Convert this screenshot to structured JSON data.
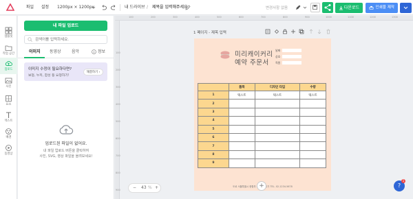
{
  "topbar": {
    "file": "파일",
    "settings": "설정",
    "size": "1200px × 1200px",
    "drive": "내 드라이브",
    "slash": "/",
    "doc_title": "제목을 입력해주세요.",
    "save_status": "변경사항 없음",
    "download": "다운로드",
    "order": "인쇄물 제작"
  },
  "rail": [
    {
      "label": "템플릿",
      "icon": "template-icon"
    },
    {
      "label": "작업 공간",
      "icon": "workspace-icon"
    },
    {
      "label": "업로드",
      "icon": "upload-cloud-icon"
    },
    {
      "label": "사진",
      "icon": "photo-icon"
    },
    {
      "label": "요소",
      "icon": "element-icon"
    },
    {
      "label": "텍스트",
      "icon": "text-icon"
    },
    {
      "label": "배경",
      "icon": "background-icon"
    },
    {
      "label": "동영상",
      "icon": "video-icon"
    }
  ],
  "panel": {
    "upload_button": "내 파일 업로드",
    "search_placeholder": "검색어를 입력하세요.",
    "tabs": [
      "이미지",
      "동영상",
      "음악",
      "정보"
    ],
    "banner_title": "이미지 수정이 필요하다면?",
    "banner_sub": "보정, 누끼, 합성 등 요청하기!",
    "banner_button": "해결하기",
    "empty_title": "업로드된 파일이 없어요.",
    "empty_desc1": "내 파일 업로드 버튼을 클릭하여",
    "empty_desc2": "사진, SVG, 영상 파일을 올려보세요!"
  },
  "canvas": {
    "page_label": "1 페이지 - 제목 입력",
    "zoom_value": "43",
    "zoom_unit": "%",
    "ruler_top": [
      "100",
      "200",
      "300",
      "400",
      "500",
      "600",
      "700",
      "800",
      "900",
      "1000",
      "1100",
      "1200",
      "1300"
    ],
    "ruler_left": [
      "100",
      "200",
      "300",
      "400",
      "500",
      "600",
      "700",
      "800",
      "900"
    ]
  },
  "document": {
    "title_line1": "미리캐이커리",
    "title_line2": "예약 주문서",
    "fields": [
      "날짜",
      "상호",
      "직원"
    ],
    "headers": [
      "품목",
      "디자인 타입",
      "수량"
    ],
    "rows": [
      {
        "num": "1",
        "c1": "텍스트",
        "c2": "텍스트",
        "c3": "텍스트"
      },
      {
        "num": "2",
        "c1": "",
        "c2": "",
        "c3": ""
      },
      {
        "num": "3",
        "c1": "",
        "c2": "",
        "c3": ""
      },
      {
        "num": "4",
        "c1": "",
        "c2": "",
        "c3": ""
      },
      {
        "num": "5",
        "c1": "",
        "c2": "",
        "c3": ""
      },
      {
        "num": "6",
        "c1": "",
        "c2": "",
        "c3": ""
      },
      {
        "num": "7",
        "c1": "",
        "c2": "",
        "c3": ""
      },
      {
        "num": "8",
        "c1": "",
        "c2": "",
        "c3": ""
      },
      {
        "num": "9",
        "c1": "",
        "c2": "",
        "c3": ""
      }
    ],
    "footer": "도로 서울특별시 종합부 공도로터리가 TEL. 02-1234-5678"
  },
  "colors": {
    "accent_green": "#1bbd70",
    "accent_blue": "#4b8ef5",
    "doc_bg": "#fde3d2",
    "table_header": "#fcd78f"
  }
}
